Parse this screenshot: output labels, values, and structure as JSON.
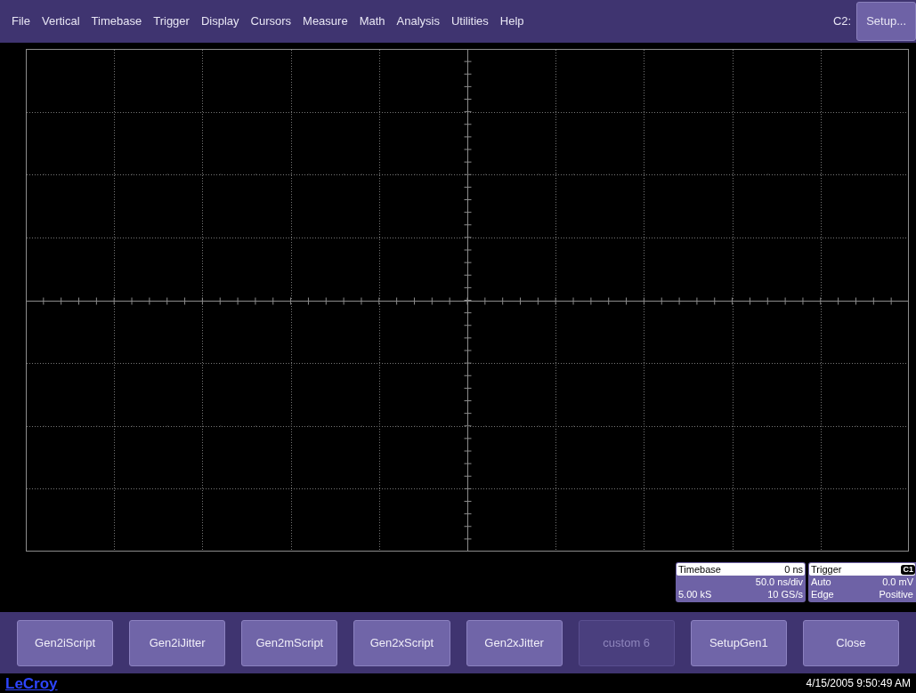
{
  "menu": [
    "File",
    "Vertical",
    "Timebase",
    "Trigger",
    "Display",
    "Cursors",
    "Measure",
    "Math",
    "Analysis",
    "Utilities",
    "Help"
  ],
  "channel_label": "C2:",
  "setup_button": "Setup...",
  "timebase": {
    "title": "Timebase",
    "delay": "0 ns",
    "scale": "50.0 ns/div",
    "samples": "5.00 kS",
    "rate": "10 GS/s"
  },
  "trigger": {
    "title": "Trigger",
    "source": "C1",
    "mode": "Auto",
    "level": "0.0 mV",
    "type": "Edge",
    "slope": "Positive"
  },
  "buttons": [
    {
      "label": "Gen2iScript",
      "disabled": false
    },
    {
      "label": "Gen2iJitter",
      "disabled": false
    },
    {
      "label": "Gen2mScript",
      "disabled": false
    },
    {
      "label": "Gen2xScript",
      "disabled": false
    },
    {
      "label": "Gen2xJitter",
      "disabled": false
    },
    {
      "label": "custom 6",
      "disabled": true
    },
    {
      "label": "SetupGen1",
      "disabled": false
    },
    {
      "label": "Close",
      "disabled": false
    }
  ],
  "footer": {
    "brand": "LeCroy",
    "datetime": "4/15/2005 9:50:49 AM"
  }
}
